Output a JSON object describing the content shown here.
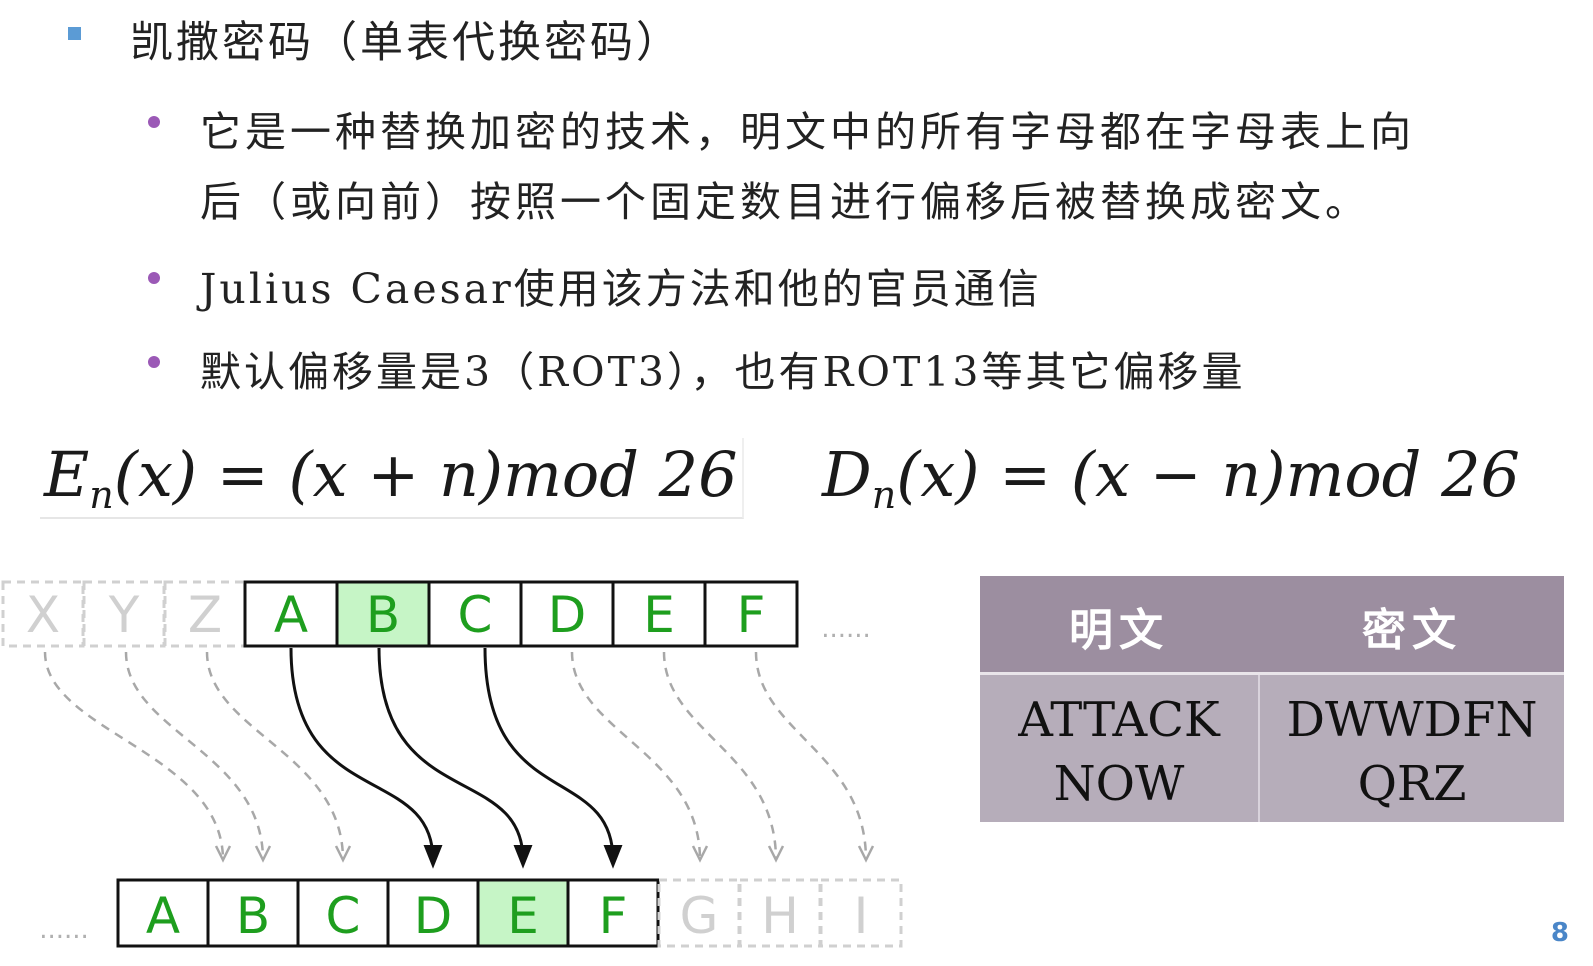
{
  "slide": {
    "heading": "凯撒密码（单表代换密码）",
    "bullets": [
      "它是一种替换加密的技术，明文中的所有字母都在字母表上向",
      "后（或向前）按照一个固定数目进行偏移后被替换成密文。",
      "Julius Caesar使用该方法和他的官员通信",
      "默认偏移量是3（ROT3），也有ROT13等其它偏移量"
    ],
    "formula_encrypt": {
      "fn": "E",
      "sub": "n",
      "arg": "(x) = (x + n)",
      "mod": "mod 26"
    },
    "formula_decrypt": {
      "fn": "D",
      "sub": "n",
      "arg": "(x) = (x − n)",
      "mod": "mod 26"
    },
    "page_number": "8"
  },
  "diagram": {
    "top_faded": [
      "X",
      "Y",
      "Z"
    ],
    "top_letters": [
      "A",
      "B",
      "C",
      "D",
      "E",
      "F"
    ],
    "top_highlight": "B",
    "bottom_letters": [
      "A",
      "B",
      "C",
      "D",
      "E",
      "F"
    ],
    "bottom_highlight": "E",
    "bottom_faded": [
      "G",
      "H",
      "I"
    ],
    "ellipsis": "......",
    "colors": {
      "letter": "#1e9e1e",
      "highlight": "#c6f5c6",
      "faded": "#d0d0d0",
      "arrow": "#111111",
      "dashed_arrow": "#a8a8a8"
    }
  },
  "table": {
    "headers": [
      "明文",
      "密文"
    ],
    "plain": "ATTACK\nNOW",
    "cipher": "DWWDFN\nQRZ",
    "colors": {
      "header_bg": "#9c8ea0",
      "body_bg": "#b6adba"
    }
  }
}
